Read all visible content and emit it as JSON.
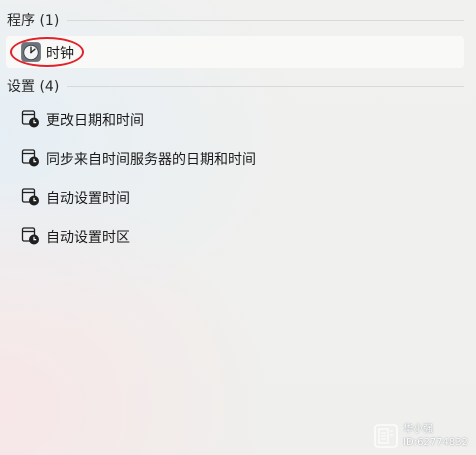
{
  "groups": {
    "apps": {
      "title": "程序 (1)",
      "items": [
        {
          "label": "时钟",
          "icon": "clock-app-icon"
        }
      ]
    },
    "settings": {
      "title": "设置 (4)",
      "items": [
        {
          "label": "更改日期和时间",
          "icon": "calendar-clock-icon"
        },
        {
          "label": "同步来自时间服务器的日期和时间",
          "icon": "calendar-clock-icon"
        },
        {
          "label": "自动设置时间",
          "icon": "calendar-clock-icon"
        },
        {
          "label": "自动设置时区",
          "icon": "calendar-clock-icon"
        }
      ]
    }
  },
  "watermark": {
    "line1": "华小强",
    "line2": "ID:62774832"
  },
  "colors": {
    "highlight_oval": "#e2222b",
    "selected_bg": "#f9f9f8"
  }
}
